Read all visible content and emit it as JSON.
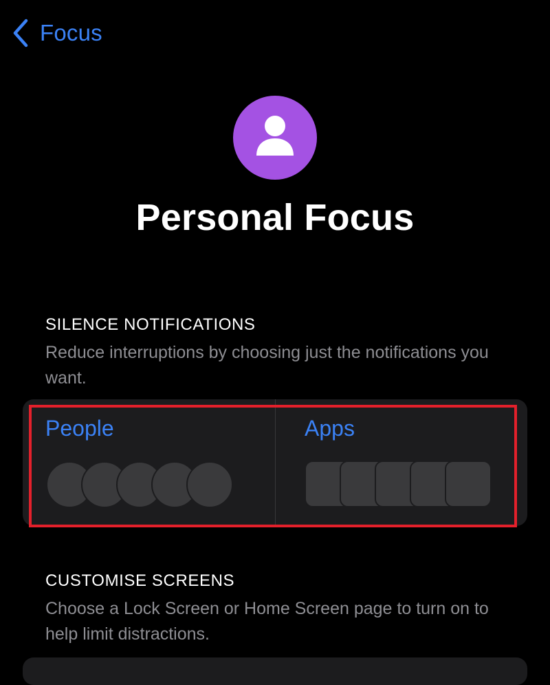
{
  "nav": {
    "back_label": "Focus",
    "back_icon": "chevron-left-icon"
  },
  "focus": {
    "icon": "person-icon",
    "icon_color": "#a452e3",
    "title": "Personal Focus"
  },
  "silence_notifications": {
    "heading": "SILENCE NOTIFICATIONS",
    "description": "Reduce interruptions by choosing just the notifications you want.",
    "people": {
      "label": "People",
      "avatar_count": 5
    },
    "apps": {
      "label": "Apps",
      "app_count": 5
    }
  },
  "customise_screens": {
    "heading": "CUSTOMISE SCREENS",
    "description": "Choose a Lock Screen or Home Screen page to turn on to help limit distractions."
  },
  "colors": {
    "accent": "#3b82f6",
    "background": "#000000",
    "card": "#1c1c1e",
    "secondary_text": "#8e8e93",
    "highlight": "#e3202b"
  }
}
